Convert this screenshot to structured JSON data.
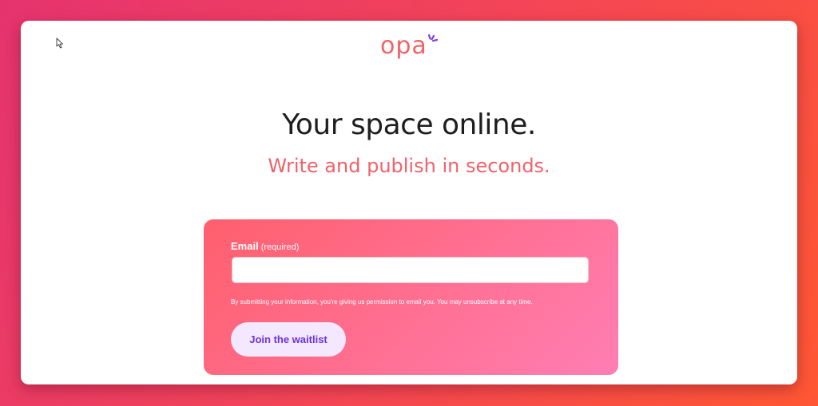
{
  "brand": {
    "name": "opa",
    "logo_color": "#f26266",
    "spark_color": "#7b3fe4"
  },
  "hero": {
    "headline": "Your space online.",
    "subheadline": "Write and publish in seconds.",
    "subheadline_color": "#f2616a"
  },
  "form": {
    "email_label": "Email",
    "email_required": "(required)",
    "email_value": "",
    "email_placeholder": "",
    "disclaimer": "By submitting your information, you're giving us permission to email you. You may unsubscribe at any time.",
    "submit_label": "Join the waitlist",
    "card_gradient_start": "#ff5f6d",
    "card_gradient_end": "#ff7eb3",
    "button_bg": "#f3e8ff",
    "button_text_color": "#6b33d6"
  }
}
